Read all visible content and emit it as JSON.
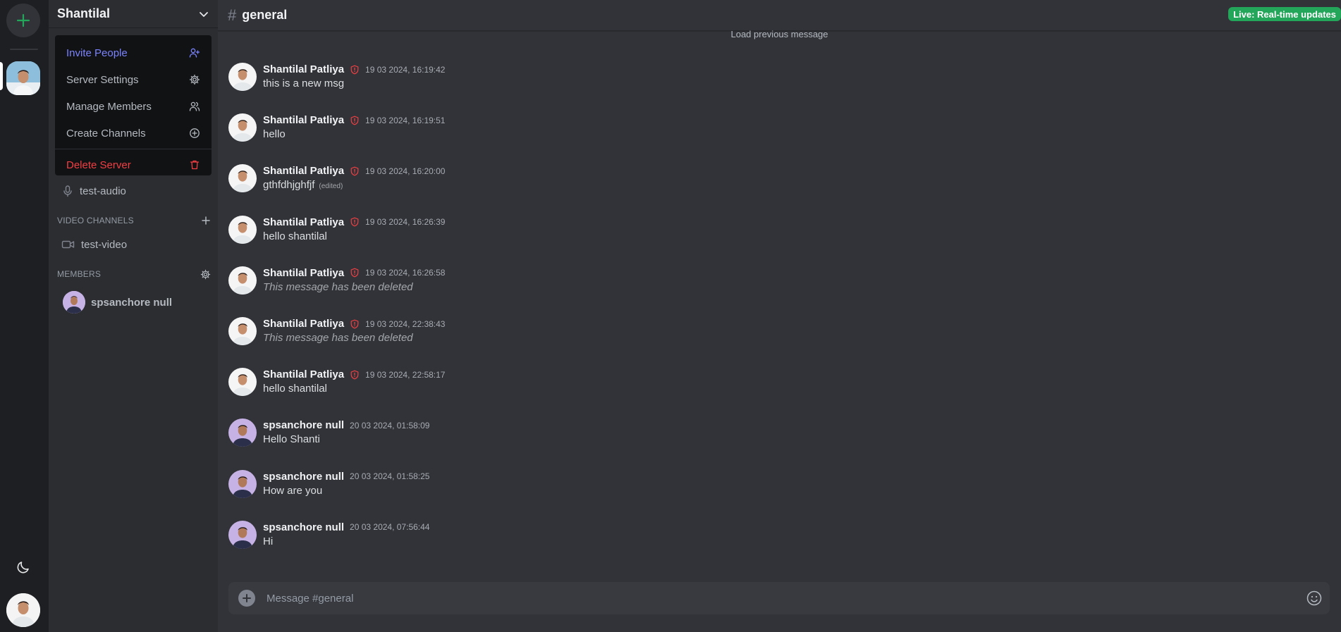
{
  "server": {
    "name": "Shantilal"
  },
  "menu": {
    "items": [
      {
        "label": "Invite People"
      },
      {
        "label": "Server Settings"
      },
      {
        "label": "Manage Members"
      },
      {
        "label": "Create Channels"
      },
      {
        "label": "Delete Server"
      }
    ]
  },
  "sidebar": {
    "audio_channel": "test-audio",
    "video_section": "VIDEO CHANNELS",
    "video_channel": "test-video",
    "members_section": "MEMBERS",
    "member_name": "spsanchore null"
  },
  "channel": {
    "hash": "#",
    "name": "general"
  },
  "live_badge": "Live: Real-time updates",
  "load_previous": "Load previous message",
  "messages": [
    {
      "author": "Shantilal Patliya",
      "admin": true,
      "time": "19 03 2024, 16:19:42",
      "text": "this is a new msg"
    },
    {
      "author": "Shantilal Patliya",
      "admin": true,
      "time": "19 03 2024, 16:19:51",
      "text": "hello"
    },
    {
      "author": "Shantilal Patliya",
      "admin": true,
      "time": "19 03 2024, 16:20:00",
      "text": "gthfdhjghfjf",
      "edited": "(edited)"
    },
    {
      "author": "Shantilal Patliya",
      "admin": true,
      "time": "19 03 2024, 16:26:39",
      "text": "hello shantilal"
    },
    {
      "author": "Shantilal Patliya",
      "admin": true,
      "time": "19 03 2024, 16:26:58",
      "text": "This message has been deleted",
      "deleted": true
    },
    {
      "author": "Shantilal Patliya",
      "admin": true,
      "time": "19 03 2024, 22:38:43",
      "text": "This message has been deleted",
      "deleted": true
    },
    {
      "author": "Shantilal Patliya",
      "admin": true,
      "time": "19 03 2024, 22:58:17",
      "text": "hello shantilal"
    },
    {
      "author": "spsanchore null",
      "admin": false,
      "time": "20 03 2024, 01:58:09",
      "text": "Hello Shanti"
    },
    {
      "author": "spsanchore null",
      "admin": false,
      "time": "20 03 2024, 01:58:25",
      "text": "How are you"
    },
    {
      "author": "spsanchore null",
      "admin": false,
      "time": "20 03 2024, 07:56:44",
      "text": "Hi"
    }
  ],
  "composer": {
    "placeholder": "Message #general"
  },
  "colors": {
    "accent_green": "#23a55a",
    "invite_blue": "#7b83ff",
    "danger_red": "#f23f43",
    "background": "#313338",
    "sidebar": "#2b2d31",
    "rail": "#1e1f22"
  },
  "icons": {
    "add_server": "plus-icon",
    "theme": "moon-icon",
    "menu_toggle": "chevron-down-icon",
    "invite": "user-plus-icon",
    "settings": "gear-icon",
    "members": "users-icon",
    "create": "plus-circle-icon",
    "delete": "trash-icon",
    "audio": "microphone-icon",
    "video": "video-icon",
    "admin": "shield-alert-icon",
    "emoji": "smile-icon"
  }
}
